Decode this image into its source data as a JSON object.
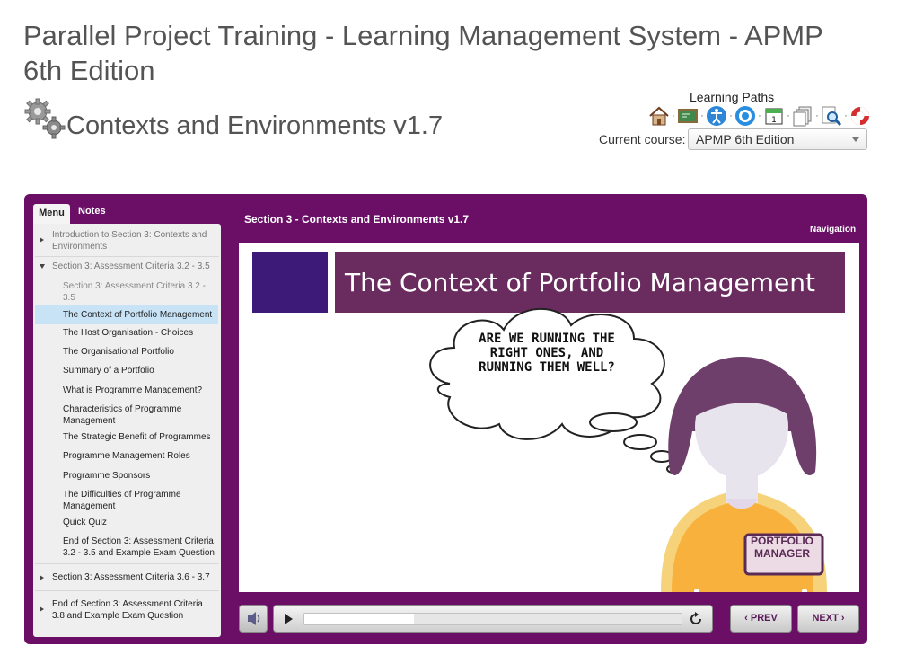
{
  "site": {
    "title": "Parallel Project Training - Learning Management System - APMP 6th Edition"
  },
  "course": {
    "title": "Contexts and Environments v1.7"
  },
  "learning_paths": {
    "label": "Learning Paths",
    "icons": [
      "home-icon",
      "blackboard-icon",
      "accessibility-icon",
      "globe-icon",
      "calendar-icon",
      "documents-icon",
      "search-icon",
      "lifebuoy-icon"
    ],
    "current_course_label": "Current course:",
    "current_course_value": "APMP 6th Edition"
  },
  "player": {
    "tabs": {
      "menu": "Menu",
      "notes": "Notes"
    },
    "slide_header": "Section 3 - Contexts and Environments v1.7",
    "navigation_label": "Navigation",
    "prev_label": "PREV",
    "next_label": "NEXT",
    "seek_progress": 0.29
  },
  "menu": {
    "items": [
      {
        "label": "Introduction to Section 3: Contexts and Environments",
        "type": "section",
        "state": "collapsed"
      },
      {
        "label": "Section 3: Assessment Criteria 3.2 - 3.5",
        "type": "section",
        "state": "expanded"
      },
      {
        "label": "Section 3: Assessment Criteria 3.2 - 3.5",
        "type": "sub",
        "greyed": true
      },
      {
        "label": "The Context of Portfolio Management",
        "type": "sub",
        "active": true
      },
      {
        "label": "The Host Organisation - Choices",
        "type": "sub"
      },
      {
        "label": "The Organisational Portfolio",
        "type": "sub"
      },
      {
        "label": "Summary of a Portfolio",
        "type": "sub"
      },
      {
        "label": "What is Programme Management?",
        "type": "sub"
      },
      {
        "label": "Characteristics of Programme Management",
        "type": "sub"
      },
      {
        "label": "The Strategic Benefit of Programmes",
        "type": "sub"
      },
      {
        "label": "Programme Management Roles",
        "type": "sub"
      },
      {
        "label": "Programme Sponsors",
        "type": "sub"
      },
      {
        "label": "The Difficulties of Programme Management",
        "type": "sub"
      },
      {
        "label": "Quick Quiz",
        "type": "sub"
      },
      {
        "label": "End of Section 3: Assessment Criteria 3.2 - 3.5 and Example Exam Question",
        "type": "sub"
      },
      {
        "label": "Section 3: Assessment Criteria 3.6 - 3.7",
        "type": "section",
        "state": "collapsed"
      },
      {
        "label": "End of Section 3: Assessment Criteria 3.8 and Example Exam Question",
        "type": "section",
        "state": "collapsed"
      }
    ]
  },
  "slide": {
    "title": "The Context of Portfolio Management",
    "bubble_text": "ARE WE RUNNING THE RIGHT ONES, AND RUNNING THEM WELL?",
    "badge_line1": "PORTFOLIO",
    "badge_line2": "MANAGER",
    "colors": {
      "banner": "#6a2c5f",
      "square": "#3e1a78",
      "shirt": "#f9b13e",
      "hair": "#6e3f6b"
    }
  },
  "colors": {
    "player_frame": "#6a0e66",
    "active_item": "#c7e3f5"
  }
}
